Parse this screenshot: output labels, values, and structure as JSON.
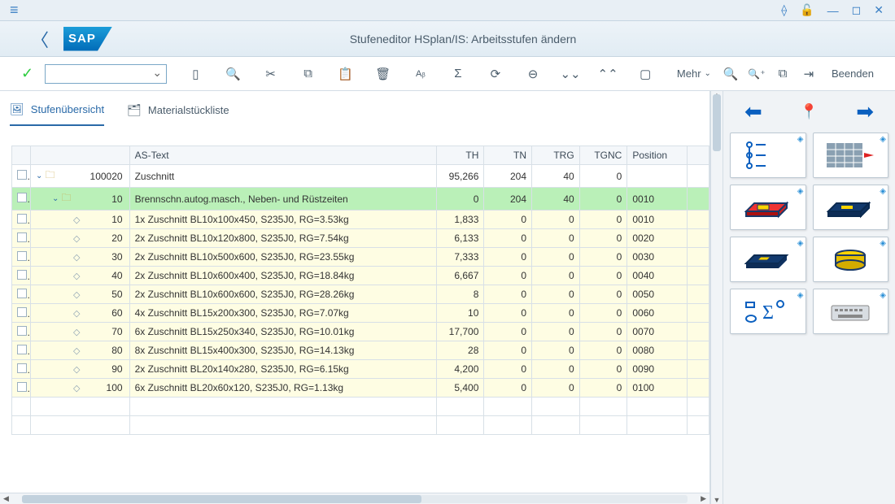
{
  "titlebar": {
    "hamburger_label": "menu"
  },
  "header": {
    "logo_text": "SAP",
    "title": "Stufeneditor HSplan/IS: Arbeitsstufen ändern"
  },
  "toolbar": {
    "mehr_label": "Mehr",
    "beenden_label": "Beenden"
  },
  "tabs": [
    {
      "label": "Stufenübersicht",
      "active": true
    },
    {
      "label": "Materialstückliste",
      "active": false
    }
  ],
  "grid": {
    "headers": {
      "text": "AS-Text",
      "th": "TH",
      "tn": "TN",
      "trg": "TRG",
      "tgnc": "TGNC",
      "position": "Position"
    },
    "rows": [
      {
        "level": 0,
        "exp": true,
        "id": "100020",
        "text": "Zuschnitt",
        "th": "95,266",
        "tn": "204",
        "trg": "40",
        "tgnc": "0",
        "pos": ""
      },
      {
        "level": 1,
        "exp": true,
        "id": "10",
        "text": "Brennschn.autog.masch., Neben- und Rüstzeiten",
        "th": "0",
        "tn": "204",
        "trg": "40",
        "tgnc": "0",
        "pos": "0010"
      },
      {
        "level": 2,
        "id": "10",
        "text": "1x Zuschnitt BL10x100x450, S235J0, RG=3.53kg",
        "th": "1,833",
        "tn": "0",
        "trg": "0",
        "tgnc": "0",
        "pos": "0010"
      },
      {
        "level": 2,
        "id": "20",
        "text": "2x Zuschnitt BL10x120x800, S235J0, RG=7.54kg",
        "th": "6,133",
        "tn": "0",
        "trg": "0",
        "tgnc": "0",
        "pos": "0020"
      },
      {
        "level": 2,
        "id": "30",
        "text": "2x Zuschnitt BL10x500x600, S235J0, RG=23.55kg",
        "th": "7,333",
        "tn": "0",
        "trg": "0",
        "tgnc": "0",
        "pos": "0030"
      },
      {
        "level": 2,
        "id": "40",
        "text": "2x Zuschnitt BL10x600x400, S235J0, RG=18.84kg",
        "th": "6,667",
        "tn": "0",
        "trg": "0",
        "tgnc": "0",
        "pos": "0040"
      },
      {
        "level": 2,
        "id": "50",
        "text": "2x Zuschnitt BL10x600x600, S235J0, RG=28.26kg",
        "th": "8",
        "tn": "0",
        "trg": "0",
        "tgnc": "0",
        "pos": "0050"
      },
      {
        "level": 2,
        "id": "60",
        "text": "4x Zuschnitt BL15x200x300, S235J0, RG=7.07kg",
        "th": "10",
        "tn": "0",
        "trg": "0",
        "tgnc": "0",
        "pos": "0060"
      },
      {
        "level": 2,
        "id": "70",
        "text": "6x Zuschnitt BL15x250x340, S235J0, RG=10.01kg",
        "th": "17,700",
        "tn": "0",
        "trg": "0",
        "tgnc": "0",
        "pos": "0070"
      },
      {
        "level": 2,
        "id": "80",
        "text": "8x Zuschnitt BL15x400x300, S235J0, RG=14.13kg",
        "th": "28",
        "tn": "0",
        "trg": "0",
        "tgnc": "0",
        "pos": "0080"
      },
      {
        "level": 2,
        "id": "90",
        "text": "2x Zuschnitt BL20x140x280, S235J0, RG=6.15kg",
        "th": "4,200",
        "tn": "0",
        "trg": "0",
        "tgnc": "0",
        "pos": "0090"
      },
      {
        "level": 2,
        "id": "100",
        "text": "6x Zuschnitt BL20x60x120, S235J0, RG=1.13kg",
        "th": "5,400",
        "tn": "0",
        "trg": "0",
        "tgnc": "0",
        "pos": "0100"
      }
    ]
  },
  "right_panel": {
    "tiles": [
      {
        "name": "structure-tile"
      },
      {
        "name": "grid-right-tile"
      },
      {
        "name": "red-plate-tile"
      },
      {
        "name": "blue-slot-tile"
      },
      {
        "name": "navy-plate-tile"
      },
      {
        "name": "yellow-cylinder-tile"
      },
      {
        "name": "sigma-tile"
      },
      {
        "name": "keyboard-tile"
      }
    ]
  }
}
